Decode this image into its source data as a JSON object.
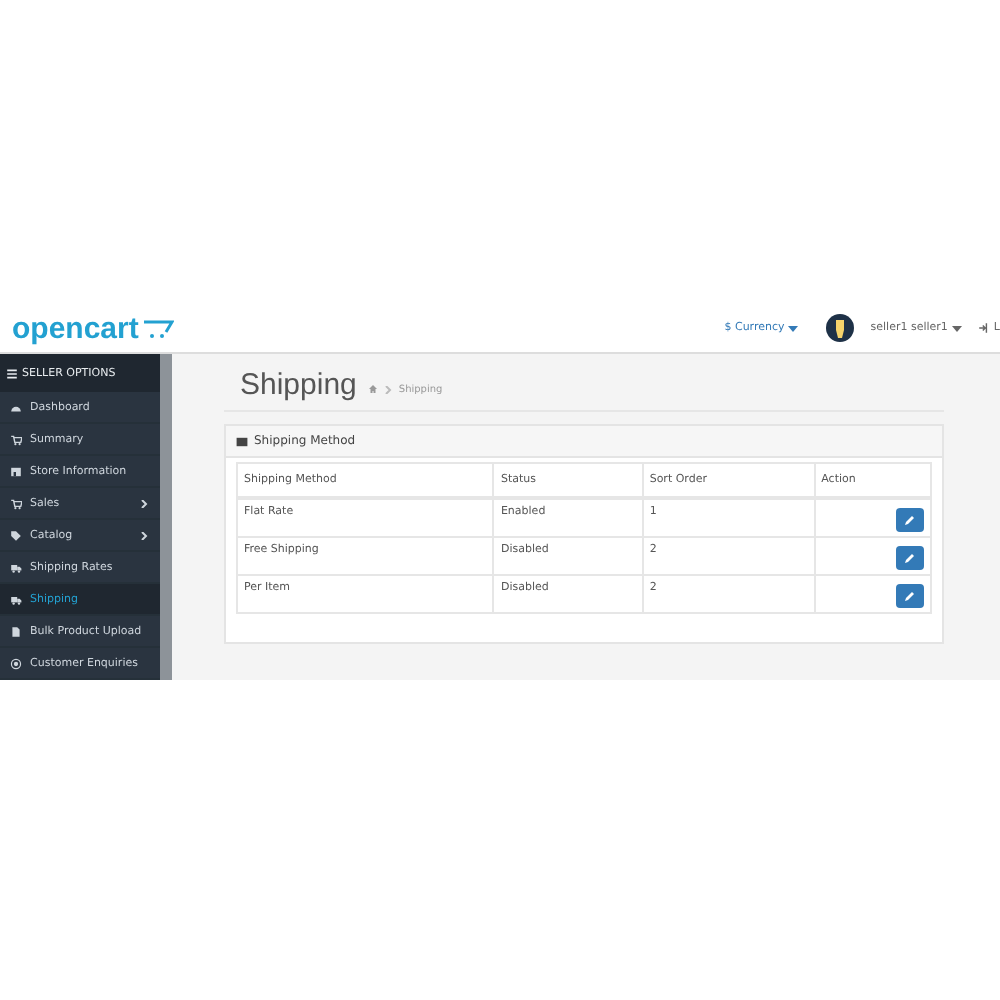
{
  "header": {
    "logo": "opencart",
    "currency": "$ Currency",
    "user": "seller1 seller1",
    "logout": "L"
  },
  "sidebar": {
    "title": "SELLER OPTIONS",
    "items": [
      {
        "label": "Dashboard",
        "kind": "dashboard",
        "selected": false,
        "expandable": false
      },
      {
        "label": "Summary",
        "kind": "cart",
        "selected": false,
        "expandable": false
      },
      {
        "label": "Store Information",
        "kind": "store",
        "selected": false,
        "expandable": false
      },
      {
        "label": "Sales",
        "kind": "cart",
        "selected": false,
        "expandable": true
      },
      {
        "label": "Catalog",
        "kind": "tag",
        "selected": false,
        "expandable": true
      },
      {
        "label": "Shipping Rates",
        "kind": "truck",
        "selected": false,
        "expandable": false
      },
      {
        "label": "Shipping",
        "kind": "truck",
        "selected": true,
        "expandable": false
      },
      {
        "label": "Bulk Product Upload",
        "kind": "file",
        "selected": false,
        "expandable": false
      },
      {
        "label": "Customer Enquiries",
        "kind": "circle",
        "selected": false,
        "expandable": false
      }
    ]
  },
  "page": {
    "title": "Shipping",
    "breadcrumb": [
      "Shipping"
    ]
  },
  "panel": {
    "title": "Shipping Method",
    "table": {
      "columns": [
        "Shipping Method",
        "Status",
        "Sort Order",
        "Action"
      ],
      "rows": [
        {
          "method": "Flat Rate",
          "status": "Enabled",
          "sort_order": "1"
        },
        {
          "method": "Free Shipping",
          "status": "Disabled",
          "sort_order": "2"
        },
        {
          "method": "Per Item",
          "status": "Disabled",
          "sort_order": "2"
        }
      ]
    }
  }
}
